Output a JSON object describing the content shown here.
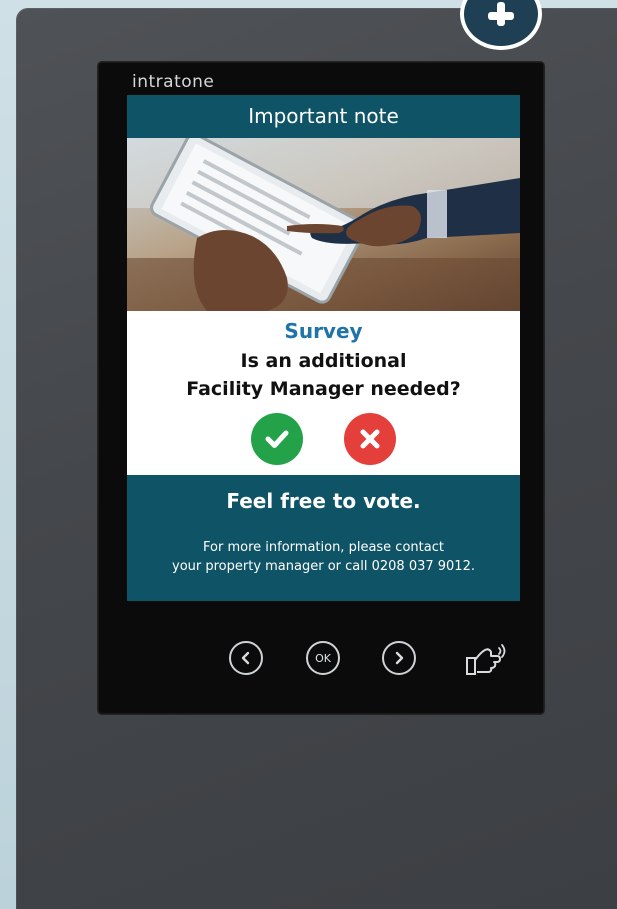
{
  "device": {
    "brand": "intratone",
    "colors": {
      "casing": "#46494d",
      "screen_header": "#0f5466",
      "survey_accent": "#1e73a8",
      "yes": "#24a24a",
      "no": "#e53f3b"
    }
  },
  "screen": {
    "header": "Important note",
    "image_icon": "document-review-photo",
    "survey_title": "Survey",
    "question_line1": "Is an additional",
    "question_line2": "Facility Manager needed?",
    "yes_icon": "check-icon",
    "no_icon": "close-icon",
    "cta": "Feel free to vote.",
    "info_line1": "For more information, please contact",
    "info_line2": "your property manager or call 0208 037 9012."
  },
  "hardware_buttons": {
    "left_icon": "chevron-left-icon",
    "ok_label": "OK",
    "right_icon": "chevron-right-icon",
    "nfc_icon": "nfc-hand-icon"
  }
}
